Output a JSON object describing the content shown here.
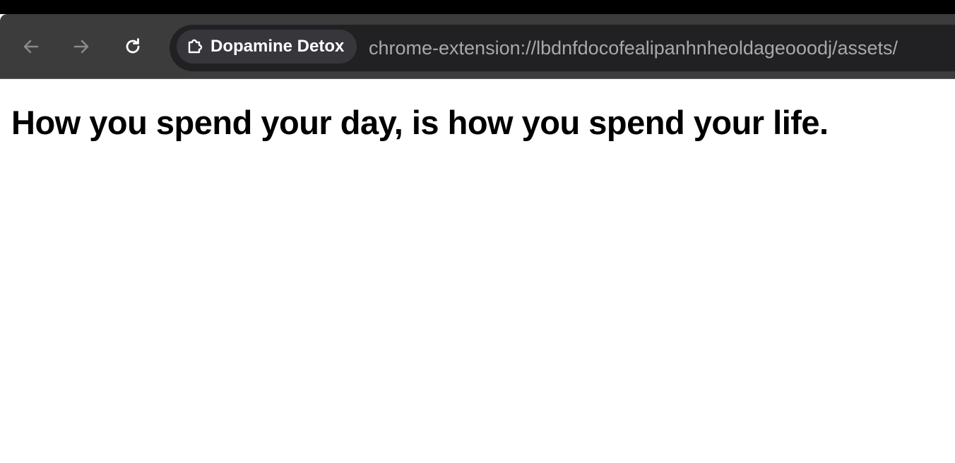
{
  "browser": {
    "site_chip_label": "Dopamine Detox",
    "url": "chrome-extension://lbdnfdocofealipanhnheoldageooodj/assets/",
    "icons": {
      "back": "back-arrow-icon",
      "forward": "forward-arrow-icon",
      "reload": "reload-icon",
      "extension": "puzzle-icon"
    },
    "colors": {
      "toolbar": "#3c3c3c",
      "omnibox": "#212124",
      "chip": "#37373b",
      "url_text": "#a8a8ad"
    }
  },
  "page": {
    "heading": "How you spend your day, is how you spend your life."
  }
}
